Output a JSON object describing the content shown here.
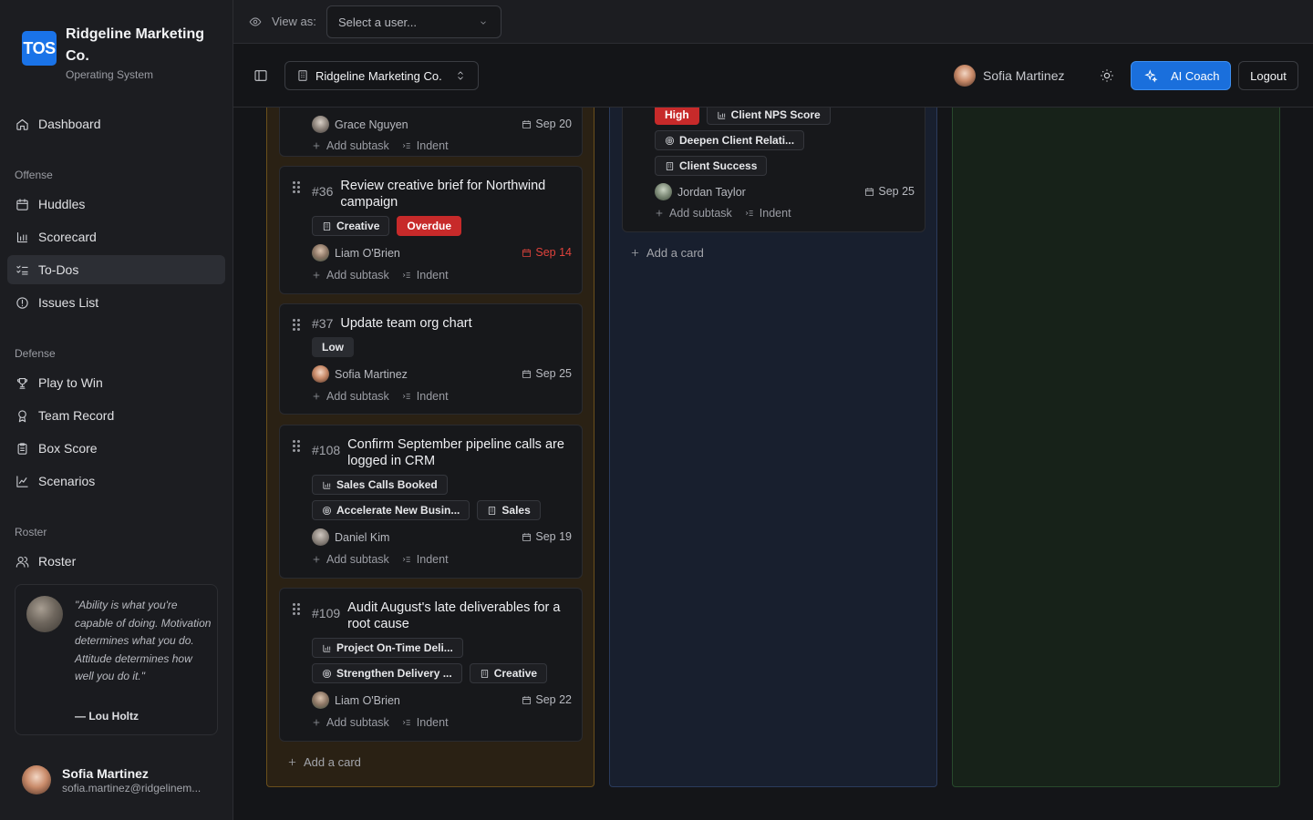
{
  "brand": {
    "logo": "TOS",
    "name": "Ridgeline Marketing Co.",
    "subtitle": "Operating System"
  },
  "nav": {
    "dashboard": "Dashboard",
    "offense_label": "Offense",
    "huddles": "Huddles",
    "scorecard": "Scorecard",
    "todos": "To-Dos",
    "issues": "Issues List",
    "defense_label": "Defense",
    "play_to_win": "Play to Win",
    "team_record": "Team Record",
    "box_score": "Box Score",
    "scenarios": "Scenarios",
    "roster_label": "Roster",
    "roster": "Roster"
  },
  "quote": {
    "text": "\"Ability is what you're capable of doing. Motivation determines what you do. Attitude determines how well you do it.\"",
    "author": "— Lou Holtz"
  },
  "user": {
    "name": "Sofia Martinez",
    "email": "sofia.martinez@ridgelinem..."
  },
  "viewas": {
    "label": "View as:",
    "placeholder": "Select a user..."
  },
  "header": {
    "company": "Ridgeline Marketing Co.",
    "user_name": "Sofia Martinez",
    "ai_coach": "AI Coach",
    "logout": "Logout"
  },
  "actions": {
    "add_subtask": "Add subtask",
    "indent": "Indent",
    "add_card": "Add a card"
  },
  "column1": {
    "partial_card": {
      "assignee": "Grace Nguyen",
      "due": "Sep 20"
    },
    "cards": [
      {
        "number": "#36",
        "title": "Review creative brief for Northwind campaign",
        "chips": [
          "Creative",
          "Overdue"
        ],
        "assignee": "Liam O'Brien",
        "due": "Sep 14"
      },
      {
        "number": "#37",
        "title": "Update team org chart",
        "chips": [
          "Low"
        ],
        "assignee": "Sofia Martinez",
        "due": "Sep 25"
      },
      {
        "number": "#108",
        "title": "Confirm September pipeline calls are logged in CRM",
        "chips": [
          "Sales Calls Booked",
          "Accelerate New Busin...",
          "Sales"
        ],
        "assignee": "Daniel Kim",
        "due": "Sep 19"
      },
      {
        "number": "#109",
        "title": "Audit August's late deliverables for a root cause",
        "chips": [
          "Project On-Time Deli...",
          "Strengthen Delivery ...",
          "Creative"
        ],
        "assignee": "Liam O'Brien",
        "due": "Sep 22"
      }
    ]
  },
  "column2": {
    "partial_card": {
      "chips": [
        "High",
        "Client NPS Score",
        "Deepen Client Relati...",
        "Client Success"
      ],
      "assignee": "Jordan Taylor",
      "due": "Sep 25"
    }
  },
  "colors": {
    "accent": "#1a6fdc",
    "overdue": "#c72a2a",
    "col1": "#2a2114",
    "col2": "#181f2e",
    "col3": "#172219"
  }
}
